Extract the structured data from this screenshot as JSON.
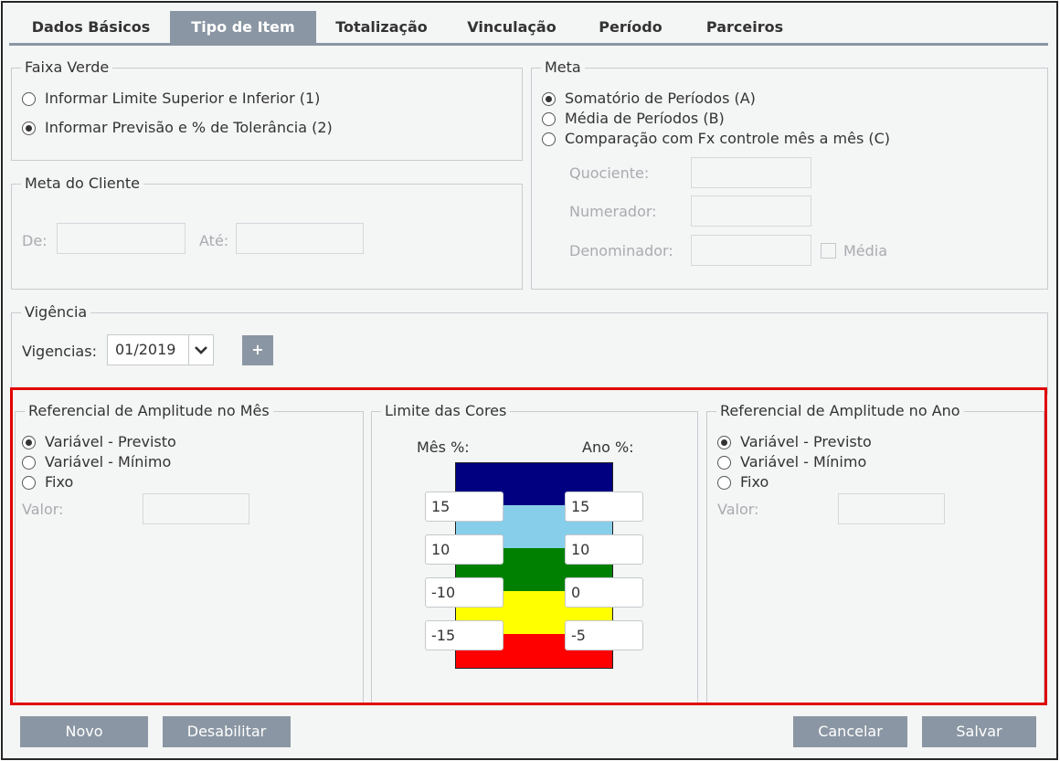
{
  "tabs": [
    {
      "label": "Dados Básicos"
    },
    {
      "label": "Tipo de Item"
    },
    {
      "label": "Totalização"
    },
    {
      "label": "Vinculação"
    },
    {
      "label": "Período"
    },
    {
      "label": "Parceiros"
    }
  ],
  "active_tab": "Tipo de Item",
  "faixa_verde": {
    "legend": "Faixa Verde",
    "options": [
      {
        "label": "Informar Limite Superior e Inferior (1)",
        "checked": false
      },
      {
        "label": "Informar Previsão e % de Tolerância (2)",
        "checked": true
      }
    ]
  },
  "meta": {
    "legend": "Meta",
    "options": [
      {
        "label": "Somatório de Períodos (A)",
        "checked": true
      },
      {
        "label": "Média de Períodos (B)",
        "checked": false
      },
      {
        "label": "Comparação com Fx controle mês a mês (C)",
        "checked": false
      }
    ],
    "quociente_label": "Quociente:",
    "numerador_label": "Numerador:",
    "denominador_label": "Denominador:",
    "media_label": "Média"
  },
  "meta_cliente": {
    "legend": "Meta do Cliente",
    "de_label": "De:",
    "ate_label": "Até:"
  },
  "vigencia": {
    "legend": "Vigência",
    "vigencias_label": "Vigencias:",
    "selected": "01/2019",
    "add_label": "+"
  },
  "ref_mes": {
    "legend": "Referencial de Amplitude no Mês",
    "options": [
      {
        "label": "Variável - Previsto",
        "checked": true
      },
      {
        "label": "Variável - Mínimo",
        "checked": false
      },
      {
        "label": "Fixo",
        "checked": false
      }
    ],
    "valor_label": "Valor:"
  },
  "limite_cores": {
    "legend": "Limite das Cores",
    "mes_label": "Mês %:",
    "ano_label": "Ano %:",
    "bands": [
      "#000080",
      "#87ceeb",
      "#008000",
      "#ffff00",
      "#ff0000"
    ],
    "mes_values": [
      "15",
      "10",
      "-10",
      "-15"
    ],
    "ano_values": [
      "15",
      "10",
      "0",
      "-5"
    ]
  },
  "ref_ano": {
    "legend": "Referencial de Amplitude no Ano",
    "options": [
      {
        "label": "Variável - Previsto",
        "checked": true
      },
      {
        "label": "Variável - Mínimo",
        "checked": false
      },
      {
        "label": "Fixo",
        "checked": false
      }
    ],
    "valor_label": "Valor:"
  },
  "buttons": {
    "novo": "Novo",
    "desabilitar": "Desabilitar",
    "cancelar": "Cancelar",
    "salvar": "Salvar"
  },
  "colors": {
    "accent": "#8a96a3",
    "highlight": "#e00000"
  }
}
